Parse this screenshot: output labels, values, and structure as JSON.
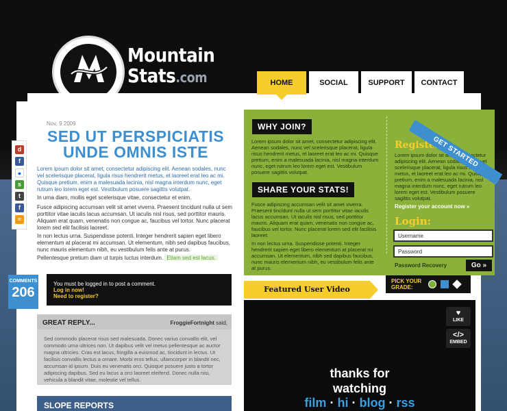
{
  "brand": {
    "line1": "Mountain",
    "line2": "Stats",
    "suffix": ".com"
  },
  "nav": [
    {
      "label": "HOME",
      "active": true
    },
    {
      "label": "SOCIAL",
      "active": false
    },
    {
      "label": "SUPPORT",
      "active": false
    },
    {
      "label": "CONTACT",
      "active": false
    }
  ],
  "social_icons": [
    "digg-icon",
    "facebook-icon",
    "flickr-icon",
    "stumbleupon-icon",
    "technorati-icon",
    "facebook-icon-2",
    "rss-icon"
  ],
  "article": {
    "date": "Nov. 9 2009",
    "title_line1": "SED UT PERSPICIATIS",
    "title_line2": "UNDE OMNIS ISTE",
    "p1": "Lorem ipsum dolor sit amet, consectetur adipiscing elit. Aenean sodales, nunc vel scelerisque placerat, ligula risus hendrerit metus, et laoreet erat leo ac mi. Quisque pretium, enim a malesuada lacinia, nisl magna interdum nunc, eget rutrum leo lorem eget est. Vestibulum posuere sagittis volutpat.",
    "p2": "In urna diam, mollis eget scelerisque vitae, consectetur et enim.",
    "p3": "Fusce adipiscing accumsan velit sit amet viverra. Praesent tincidunt nulla ut sem porttitor vitae iaculis lacus accumsan. Ut iaculis nisl risus, sed porttitor mauris. Aliquam erat quam, venenatis non congue ac, faucibus vel tortor. Nunc placerat lorem sed elit facilisis laoreet.",
    "p4": "In non lectus urna. Suspendisse potenti. Integer hendrerit sapien eget libero elementum at placerat mi accumsan. Ut elementum, nibh sed dapibus faucibus, nunc mauris elementum nibh, eu vestibulum felis ante at purus.",
    "p5": "Pellentesque pretium diam ut turpis luctus interdum.",
    "more_link": "Etiam sed est lacus."
  },
  "comments": {
    "label": "COMMENTS",
    "count": "206",
    "login_text": "You must be logged in to post a comment.",
    "login_link": "Log in now!",
    "register_link": "Need to register?"
  },
  "reply": {
    "title": "GREAT REPLY...",
    "user": "FroggieFortnight",
    "said": " said,",
    "text": "Sed commodo placerat risus sed malesuada. Donec varius convallis elit, vel commodo urna ultrices non. Ut dapibus velit vel metus pellentesque ac auctor magna ultricies. Cras est lacus, fringilla a euismod ac, tincidunt in lectus. Ut facilisis convallis lectus a ornare. Morbi eros tellus, ullamcorper in blandit nec, accumsan id ipsum. Duis eu venenatis orci. Quisque posuere justo a tortor adipiscing dapibus. Sed eu lacus a orci laoreet eleifend. Donec nulla nisi, vehicula a blandit vitae, molestie vel tellus."
  },
  "slope": {
    "title": "SLOPE REPORTS"
  },
  "join": {
    "why_title": "WHY JOIN?",
    "why_text": "Lorem ipsum dolor sit amet, consectetur adipiscing elit. Aenean sodales, nunc vel scelerisque placerat, ligula risus hendrerit metus, et laoreet erat leo ac mi. Quisque pretium, enim a malesuada lacinia, nisl magna interdum nunc, eget rutrum leo lorem eget est. Vestibulum posuere sagittis volutpat.",
    "share_title": "SHARE YOUR STATS!",
    "share_text": "Fusce adipiscing accumsan velit sit amet viverra. Praesent tincidunt nulla ut sem porttitor vitae iaculis lacus accumsan. Ut iaculis nisl risus, sed porttitor mauris. Aliquam erat quam, venenatis non congue ac, faucibus vel tortor. Nunc placerat lorem sed elit facilisis laoreet.",
    "share_text2": "In non lectus urna. Suspendisse potenti. Integer hendrerit sapien eget libero elementum at placerat mi accumsan. Ut elementum, nibh sed dapibus faucibus, nunc mauris elementum nibh, eu vestibulum felis ante at purus.",
    "ribbon": "GET STARTED",
    "register_title": "Register:",
    "register_text": "Lorem ipsum dolor sit amet, consectetur adipiscing elit. Aenean sodales, nunc vel scelerisque placerat, ligula risus hendrerit metus, et laoreet erat leo ac mi. Quisque pretium, enim a malesuada lacinia, nisl magna interdum nunc, eget rutrum leo lorem eget est. Vestibulum posuere sagittis volutpat.",
    "register_link": "Register your account now »",
    "login_title": "Login:",
    "username_placeholder": "Username",
    "password_placeholder": "Password",
    "password_recovery": "Password Recovery",
    "go_label": "Go »"
  },
  "video": {
    "tab": "Featured User Video",
    "grade_label_line1": "PICK YOUR",
    "grade_label_line2": "GRADE:",
    "grade_colors": [
      "#7ab03a",
      "#3d8fd0",
      "#ffffff"
    ],
    "like": "LIKE",
    "embed": "EMBED",
    "thanks_line1": "thanks for",
    "thanks_line2": "watching",
    "links": [
      "film",
      "hi",
      "blog",
      "rss"
    ],
    "separator": "·"
  },
  "colors": {
    "accent_blue": "#3d8fd0",
    "accent_yellow": "#f7cd2c",
    "accent_green": "#8cb13a"
  }
}
